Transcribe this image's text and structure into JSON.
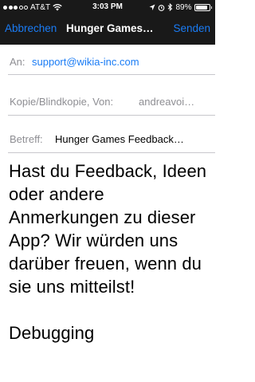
{
  "status_bar": {
    "carrier": "AT&T",
    "time": "3:03 PM",
    "battery": "89%",
    "battery_level": 0.89,
    "signal_bars": 5,
    "signal_filled": 3,
    "icons": [
      "signal-icon",
      "wifi-icon",
      "location-arrow-icon",
      "alarm-icon",
      "bluetooth-icon",
      "battery-icon"
    ]
  },
  "nav": {
    "cancel_label": "Abbrechen",
    "title": "Hunger Games…",
    "send_label": "Senden",
    "accent_color": "#1a7cf5"
  },
  "fields": {
    "to": {
      "label": "An:",
      "value": "support@wikia-inc.com"
    },
    "cc": {
      "label": "Kopie/Blindkopie, Von:",
      "value": "andreavoi…"
    },
    "subject": {
      "label": "Betreff:",
      "value": "Hunger Games Feedback…"
    }
  },
  "body": {
    "text": "Hast du Feedback, Ideen oder andere Anmerkungen zu dieser App? Wir würden uns darüber freuen, wenn du sie uns mitteilst!\n\nDebugging"
  }
}
